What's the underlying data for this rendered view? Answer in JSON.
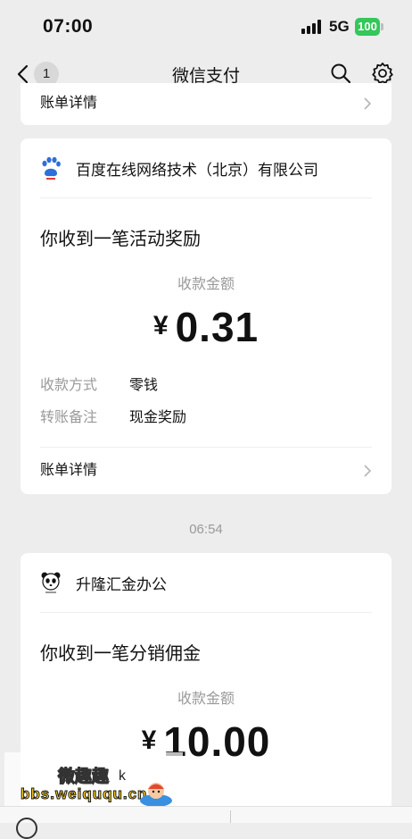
{
  "status_bar": {
    "time": "07:00",
    "network": "5G",
    "battery": "100"
  },
  "nav": {
    "back_badge": "1",
    "title": "微信支付"
  },
  "top_card": {
    "bill_detail_label": "账单详情"
  },
  "card1": {
    "merchant": "百度在线网络技术（北京）有限公司",
    "headline": "你收到一笔活动奖励",
    "amount_label": "收款金额",
    "currency": "¥",
    "amount": "0.31",
    "details": [
      {
        "key": "收款方式",
        "value": "零钱"
      },
      {
        "key": "转账备注",
        "value": "现金奖励"
      }
    ],
    "bill_detail_label": "账单详情"
  },
  "time_separator": "06:54",
  "card2": {
    "merchant": "升隆汇金办公",
    "headline": "你收到一笔分销佣金",
    "amount_label": "收款金额",
    "currency": "¥",
    "amount": "10.00"
  },
  "watermark": {
    "site_name": "微趣趣",
    "url": "bbs.weiququ.cn"
  },
  "colors": {
    "background": "#ededed",
    "card": "#ffffff",
    "battery": "#34c759",
    "secondary_text": "#9a9a9a"
  }
}
